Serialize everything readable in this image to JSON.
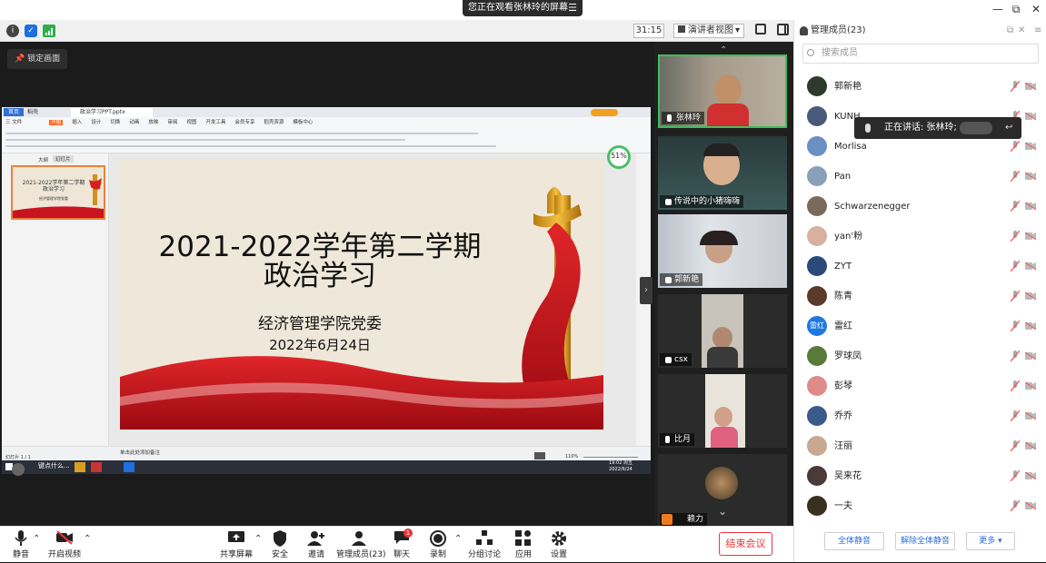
{
  "titlebar": {
    "banner": "您正在观看张林玲的屏幕",
    "banner_menu": "☰",
    "min": "—",
    "max": "⧉",
    "close": "✕"
  },
  "toolbar": {
    "timer": "31:15",
    "view_mode": "演讲者视图",
    "view_caret": "▾"
  },
  "stage": {
    "lock_label": "锁定画面"
  },
  "ppt": {
    "tab_home": "首页",
    "tab_doc": "稻壳",
    "tab_file": "政治学习PPT.pptx",
    "ribbon_tabs": [
      "三 文件",
      "开始",
      "插入",
      "设计",
      "切换",
      "动画",
      "放映",
      "审阅",
      "视图",
      "开发工具",
      "会员专享",
      "稻壳资源",
      "模板中心"
    ],
    "left_tabs": [
      "大纲",
      "幻灯片"
    ],
    "thumb_title": "2021-2022学年第二学期\n政治学习",
    "thumb_sub": "经济管理学院党委",
    "slide_title_line1": "2021-2022学年第二学期",
    "slide_title_line2": "政治学习",
    "slide_org": "经济管理学院党委",
    "slide_date": "2022年6月24日",
    "notes_hint": "单击此处添加备注",
    "status_left": "幻灯片 1 / 1",
    "zoom": "110%",
    "float_value": "51",
    "float_unit": "%",
    "taskbar_search": "键点什么...",
    "clock_time": "19:02 周五",
    "clock_date": "2022/6/24"
  },
  "gallery": {
    "tiles": [
      {
        "name": "张林玲"
      },
      {
        "name": "传说中的小猪嗨嗨"
      },
      {
        "name": "郭新艳"
      },
      {
        "name": "csx"
      },
      {
        "name": "比月"
      },
      {
        "name": "赖力"
      }
    ],
    "more_caret": "⌄"
  },
  "speaker": {
    "label": "正在讲话: 张林玲;"
  },
  "panel": {
    "title": "管理成员(23)",
    "search_placeholder": "搜索成员",
    "members": [
      {
        "name": "郭新艳",
        "avatar_color": "#2e3b2a",
        "avatar_text": ""
      },
      {
        "name": "KUNH",
        "avatar_color": "#4a5a7a",
        "avatar_text": ""
      },
      {
        "name": "Morlisa",
        "avatar_color": "#6a8fc2",
        "avatar_text": ""
      },
      {
        "name": "Pan",
        "avatar_color": "#8aa0b8",
        "avatar_text": ""
      },
      {
        "name": "Schwarzenegger",
        "avatar_color": "#7a6a5a",
        "avatar_text": ""
      },
      {
        "name": "yan'粉",
        "avatar_color": "#d8b0a0",
        "avatar_text": ""
      },
      {
        "name": "ZYT",
        "avatar_color": "#2b4a7a",
        "avatar_text": ""
      },
      {
        "name": "陈青",
        "avatar_color": "#5a3a2a",
        "avatar_text": ""
      },
      {
        "name": "雷红",
        "avatar_color": "#1e78e0",
        "avatar_text": "雷红"
      },
      {
        "name": "罗球凤",
        "avatar_color": "#5a7a3a",
        "avatar_text": ""
      },
      {
        "name": "彭琴",
        "avatar_color": "#e08a8a",
        "avatar_text": ""
      },
      {
        "name": "乔乔",
        "avatar_color": "#3a5a8a",
        "avatar_text": ""
      },
      {
        "name": "汪丽",
        "avatar_color": "#c8a890",
        "avatar_text": ""
      },
      {
        "name": "吴来花",
        "avatar_color": "#4a3a3a",
        "avatar_text": ""
      },
      {
        "name": "一夫",
        "avatar_color": "#3a3020",
        "avatar_text": ""
      }
    ],
    "btn_mute_all": "全体静音",
    "btn_unmute_all": "解除全体静音",
    "btn_more": "更多 ▾"
  },
  "bottombar": {
    "mute": "静音",
    "video": "开启视频",
    "share": "共享屏幕",
    "security": "安全",
    "invite": "邀请",
    "members": "管理成员(23)",
    "chat": "聊天",
    "chat_badge": "1",
    "record": "录制",
    "breakout": "分组讨论",
    "apps": "应用",
    "settings": "设置",
    "end": "结束会议"
  },
  "colors": {
    "accent": "#2f6fd6",
    "danger": "#e33333",
    "ppt_orange": "#e8823a",
    "ribbon_red": "#c8141e"
  }
}
